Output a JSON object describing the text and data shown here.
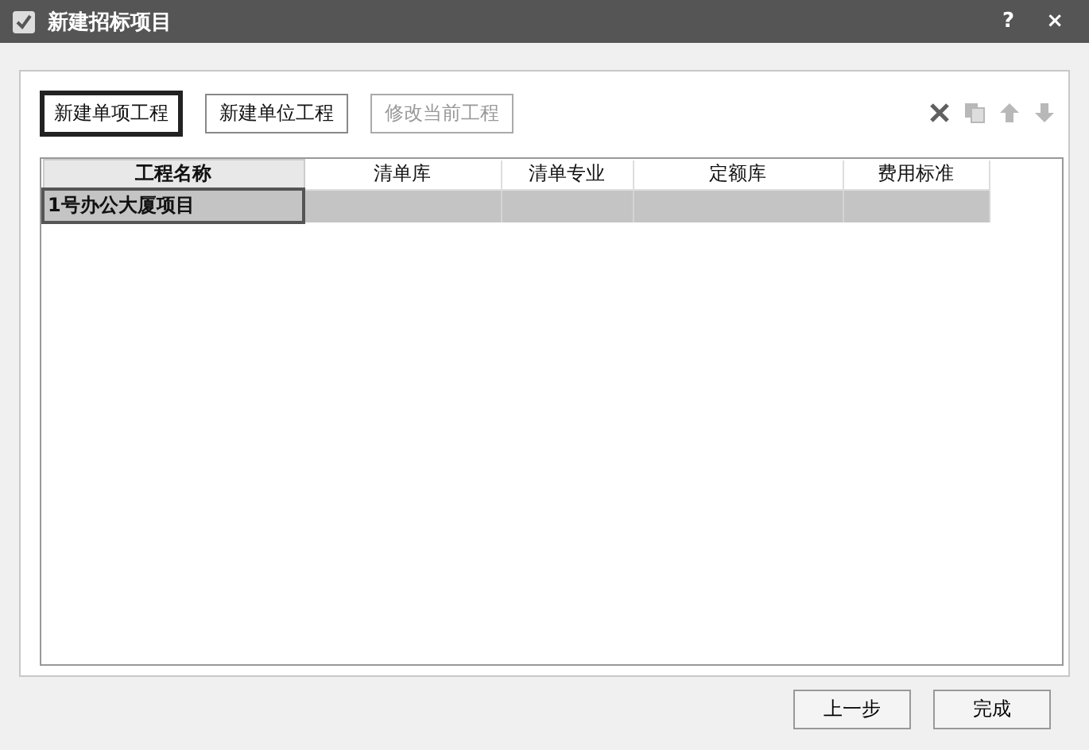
{
  "window": {
    "title": "新建招标项目",
    "help": "?",
    "close": "×"
  },
  "toolbar": {
    "buttons": [
      {
        "label": "新建单项工程",
        "selected": true,
        "disabled": false
      },
      {
        "label": "新建单位工程",
        "selected": false,
        "disabled": false
      },
      {
        "label": "修改当前工程",
        "selected": false,
        "disabled": true
      }
    ],
    "tools": [
      {
        "kind": "delete",
        "disabled": false
      },
      {
        "kind": "copy",
        "disabled": true
      },
      {
        "kind": "up",
        "disabled": true
      },
      {
        "kind": "down",
        "disabled": true
      }
    ]
  },
  "table": {
    "columns": [
      "工程名称",
      "清单库",
      "清单专业",
      "定额库",
      "费用标准"
    ],
    "rows": [
      {
        "cells": [
          "1号办公大厦项目",
          "",
          "",
          "",
          ""
        ],
        "selected": true
      }
    ]
  },
  "footer": {
    "buttons": [
      "上一步",
      "完成"
    ]
  }
}
